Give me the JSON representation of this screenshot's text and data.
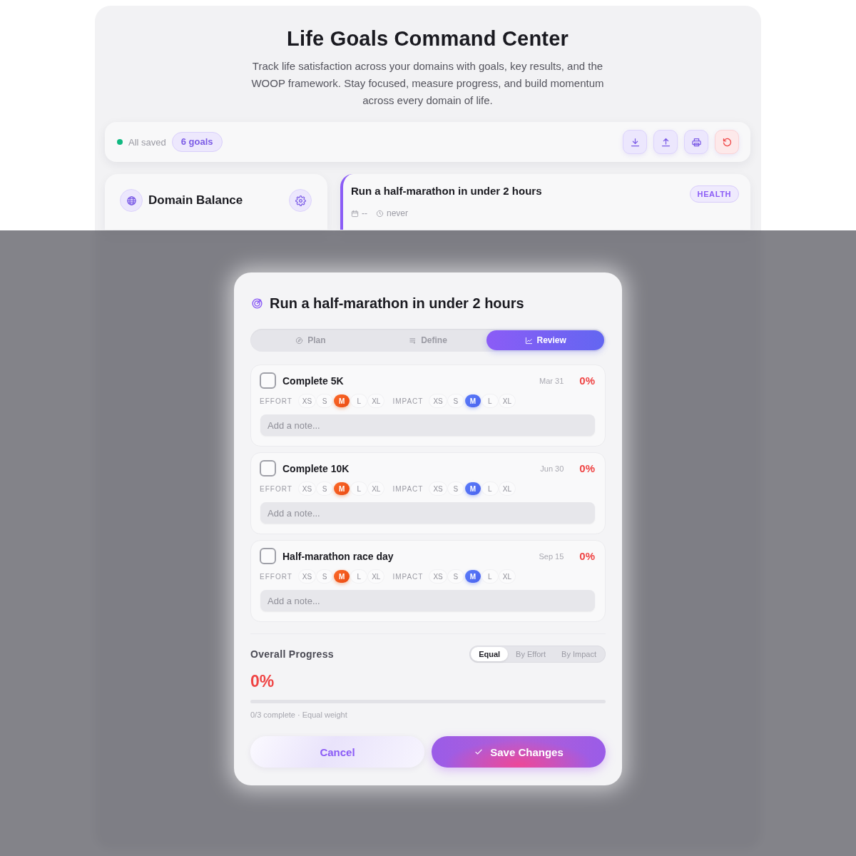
{
  "page": {
    "title": "Life Goals Command Center",
    "subtitle": "Track life satisfaction across your domains with goals, key results, and the WOOP framework. Stay focused, measure progress, and build momentum across every domain of life."
  },
  "toolbar": {
    "saved": true,
    "status": "All saved",
    "goal_count": "6 goals"
  },
  "domain_panel": {
    "title": "Domain Balance"
  },
  "goal_card": {
    "title": "Run a half-marathon in under 2 hours",
    "tag": "HEALTH",
    "date": "--",
    "updated": "never"
  },
  "modal": {
    "title": "Run a half-marathon in under 2 hours",
    "tabs": [
      {
        "label": "Plan",
        "selected": false
      },
      {
        "label": "Define",
        "selected": false
      },
      {
        "label": "Review",
        "selected": true
      }
    ],
    "key_results": [
      {
        "title": "Complete 5K",
        "checked": false,
        "date": "Mar 31",
        "percent": "0%",
        "effort_label": "EFFORT",
        "effort": [
          {
            "label": "XS",
            "selected": false
          },
          {
            "label": "S",
            "selected": false
          },
          {
            "label": "M",
            "selected": true
          },
          {
            "label": "L",
            "selected": false
          },
          {
            "label": "XL",
            "selected": false
          }
        ],
        "impact_label": "IMPACT",
        "impact": [
          {
            "label": "XS",
            "selected": false
          },
          {
            "label": "S",
            "selected": false
          },
          {
            "label": "M",
            "selected": true
          },
          {
            "label": "L",
            "selected": false
          },
          {
            "label": "XL",
            "selected": false
          }
        ],
        "note": {
          "placeholder": "Add a note..."
        }
      },
      {
        "title": "Complete 10K",
        "checked": false,
        "date": "Jun 30",
        "percent": "0%",
        "effort_label": "EFFORT",
        "effort": [
          {
            "label": "XS",
            "selected": false
          },
          {
            "label": "S",
            "selected": false
          },
          {
            "label": "M",
            "selected": true
          },
          {
            "label": "L",
            "selected": false
          },
          {
            "label": "XL",
            "selected": false
          }
        ],
        "impact_label": "IMPACT",
        "impact": [
          {
            "label": "XS",
            "selected": false
          },
          {
            "label": "S",
            "selected": false
          },
          {
            "label": "M",
            "selected": true
          },
          {
            "label": "L",
            "selected": false
          },
          {
            "label": "XL",
            "selected": false
          }
        ],
        "note": {
          "placeholder": "Add a note..."
        }
      },
      {
        "title": "Half-marathon race day",
        "checked": false,
        "date": "Sep 15",
        "percent": "0%",
        "effort_label": "EFFORT",
        "effort": [
          {
            "label": "XS",
            "selected": false
          },
          {
            "label": "S",
            "selected": false
          },
          {
            "label": "M",
            "selected": true
          },
          {
            "label": "L",
            "selected": false
          },
          {
            "label": "XL",
            "selected": false
          }
        ],
        "impact_label": "IMPACT",
        "impact": [
          {
            "label": "XS",
            "selected": false
          },
          {
            "label": "S",
            "selected": false
          },
          {
            "label": "M",
            "selected": true
          },
          {
            "label": "L",
            "selected": false
          },
          {
            "label": "XL",
            "selected": false
          }
        ],
        "note": {
          "placeholder": "Add a note..."
        }
      }
    ],
    "progress": {
      "label": "Overall Progress",
      "modes": [
        {
          "label": "Equal",
          "selected": true
        },
        {
          "label": "By Effort",
          "selected": false
        },
        {
          "label": "By Impact",
          "selected": false
        }
      ],
      "percent": "0%",
      "level": 0,
      "summary": "0/3 complete · Equal weight"
    },
    "buttons": [
      {
        "kind": "secondary",
        "label": "Cancel"
      },
      {
        "kind": "primary",
        "label": "Save Changes"
      }
    ]
  }
}
